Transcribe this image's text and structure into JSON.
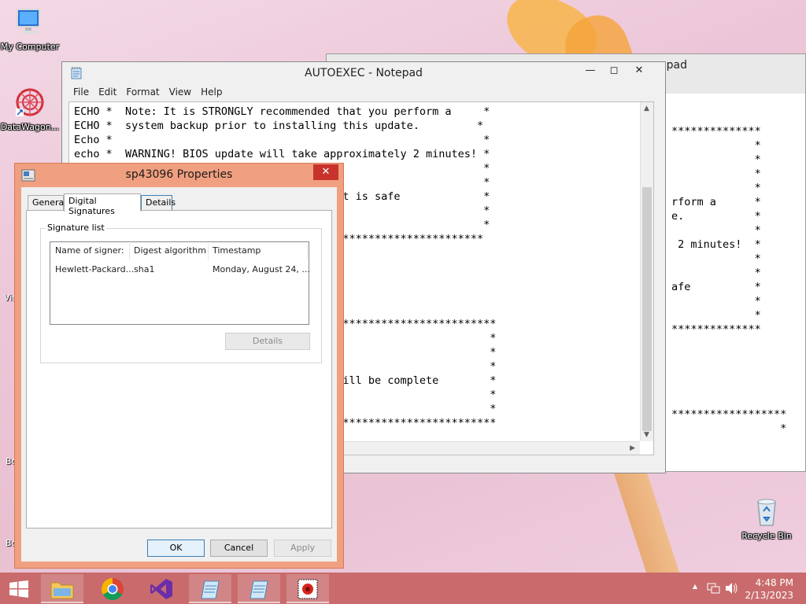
{
  "desktop": {
    "icons": {
      "my_computer": "My Computer",
      "datawagon": "DataWagon...",
      "recycle_bin": "Recycle Bin"
    },
    "partial_labels": [
      "Vis",
      "Bo",
      "Bo"
    ]
  },
  "back_notepad": {
    "title_fragment": "pad",
    "lines": [
      "",
      "",
      "**************",
      "             *",
      "             *",
      "             *",
      "             *",
      "rform a      *",
      "e.           *",
      "             *",
      " 2 minutes!  *",
      "             *",
      "             *",
      "afe          *",
      "             *",
      "             *",
      "**************",
      "",
      "",
      "",
      "",
      "",
      "******************",
      "                 *"
    ]
  },
  "notepad": {
    "title": "AUTOEXEC - Notepad",
    "menu": [
      "File",
      "Edit",
      "Format",
      "View",
      "Help"
    ],
    "lines": [
      "ECHO *  Note: It is STRONGLY recommended that you perform a     *",
      "ECHO *  system backup prior to installing this update.         *",
      "Echo *                                                          *",
      "echo *  WARNING! BIOS update will take approximately 2 minutes! *",
      "                                       E!!                      *",
      "                                                                *",
      "                                       n it is safe             *",
      "                                                                *",
      "                                                                *",
      "                                       *************************",
      "",
      "",
      "",
      "",
      "",
      "                                       ***************************",
      "                                                                 *",
      "                                       .                         *",
      "                                                                 *",
      "                                       e will be complete        *",
      "                                                                 *",
      "                                                                 *",
      "                                       ***************************"
    ]
  },
  "properties": {
    "title": "sp43096 Properties",
    "close_glyph": "✕",
    "tabs": [
      "General",
      "Digital Signatures",
      "Details"
    ],
    "group_label": "Signature list",
    "columns": [
      "Name of signer:",
      "Digest algorithm",
      "Timestamp"
    ],
    "rows": [
      [
        "Hewlett-Packard...",
        "sha1",
        "Monday, August 24, ..."
      ]
    ],
    "details_button": "Details",
    "ok": "OK",
    "cancel": "Cancel",
    "apply": "Apply"
  },
  "taskbar": {
    "time": "4:48 PM",
    "date": "2/13/2023"
  },
  "colors": {
    "taskbar": "#c96b6c",
    "dialog_frame": "#f0a080",
    "close_red": "#c7332c"
  }
}
